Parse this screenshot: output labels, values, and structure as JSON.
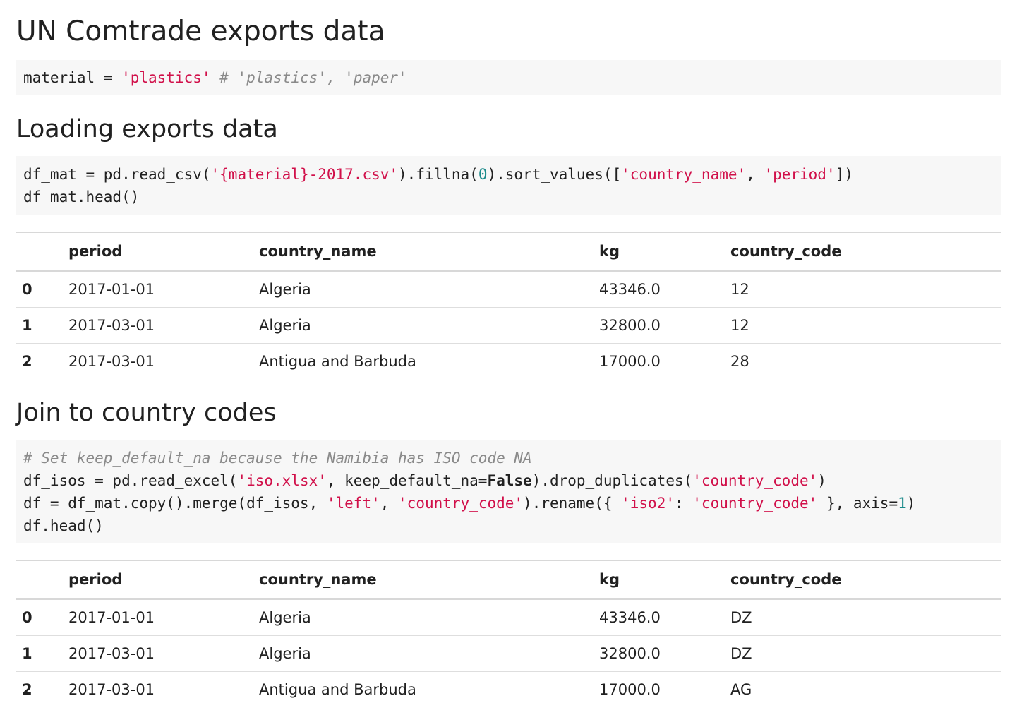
{
  "title": "UN Comtrade exports data",
  "cell1": {
    "var": "material",
    "eq": " = ",
    "str": "'plastics'",
    "comment": " # 'plastics', 'paper'"
  },
  "section2": {
    "heading": "Loading exports data"
  },
  "cell2": {
    "line1_a": "df_mat = pd.read_csv(",
    "line1_s1": "'{material}-2017.csv'",
    "line1_b": ").fillna(",
    "line1_n": "0",
    "line1_c": ").sort_values([",
    "line1_s2": "'country_name'",
    "line1_d": ", ",
    "line1_s3": "'period'",
    "line1_e": "])",
    "line2": "df_mat.head()"
  },
  "table1": {
    "columns": [
      "",
      "period",
      "country_name",
      "kg",
      "country_code"
    ],
    "rows": [
      [
        "0",
        "2017-01-01",
        "Algeria",
        "43346.0",
        "12"
      ],
      [
        "1",
        "2017-03-01",
        "Algeria",
        "32800.0",
        "12"
      ],
      [
        "2",
        "2017-03-01",
        "Antigua and Barbuda",
        "17000.0",
        "28"
      ]
    ]
  },
  "section3": {
    "heading": "Join to country codes"
  },
  "cell3": {
    "comment": "# Set keep_default_na because the Namibia has ISO code NA",
    "l2_a": "df_isos = pd.read_excel(",
    "l2_s1": "'iso.xlsx'",
    "l2_b": ", keep_default_na=",
    "l2_k": "False",
    "l2_c": ").drop_duplicates(",
    "l2_s2": "'country_code'",
    "l2_d": ")",
    "l3_a": "df = df_mat.copy().merge(df_isos, ",
    "l3_s1": "'left'",
    "l3_b": ", ",
    "l3_s2": "'country_code'",
    "l3_c": ").rename({ ",
    "l3_s3": "'iso2'",
    "l3_d": ": ",
    "l3_s4": "'country_code'",
    "l3_e": " }, axis=",
    "l3_n": "1",
    "l3_f": ")",
    "l4": "df.head()"
  },
  "table2": {
    "columns": [
      "",
      "period",
      "country_name",
      "kg",
      "country_code"
    ],
    "rows": [
      [
        "0",
        "2017-01-01",
        "Algeria",
        "43346.0",
        "DZ"
      ],
      [
        "1",
        "2017-03-01",
        "Algeria",
        "32800.0",
        "DZ"
      ],
      [
        "2",
        "2017-03-01",
        "Antigua and Barbuda",
        "17000.0",
        "AG"
      ]
    ]
  }
}
